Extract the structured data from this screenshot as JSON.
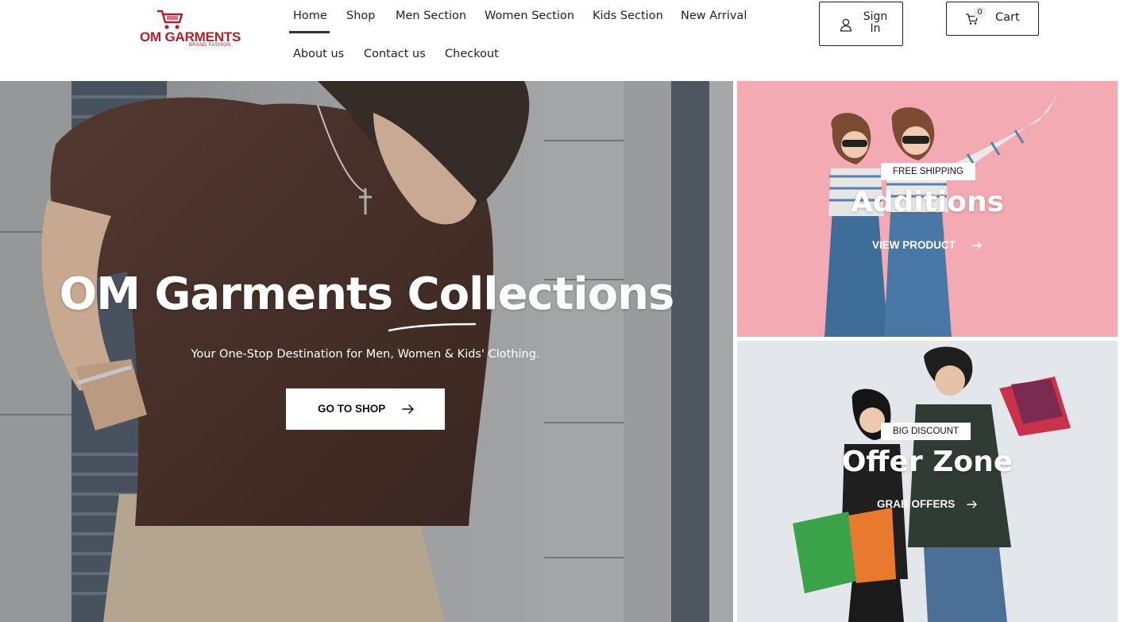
{
  "brand": {
    "name": "OM GARMENTS",
    "tagline": "BRAND FASHION",
    "color": "#b3202a"
  },
  "nav": {
    "items": [
      {
        "label": "Home",
        "active": true
      },
      {
        "label": "Shop"
      },
      {
        "label": "Men Section"
      },
      {
        "label": "Women Section"
      },
      {
        "label": "Kids Section"
      },
      {
        "label": "New Arrival"
      },
      {
        "label": "About us"
      },
      {
        "label": "Contact us"
      },
      {
        "label": "Checkout"
      }
    ]
  },
  "account": {
    "signin_label": "Sign In",
    "signin_icon": "user-icon",
    "cart_label": "Cart",
    "cart_icon": "cart-icon",
    "cart_count": "0"
  },
  "hero": {
    "title": "OM Garments Collections",
    "subtitle": "Your One-Stop Destination for Men, Women & Kids' Clothing.",
    "cta_label": "GO TO SHOP",
    "cta_icon": "arrow-right-icon"
  },
  "banners": [
    {
      "tag": "FREE SHIPPING",
      "title": "Additions",
      "link_label": "VIEW PRODUCT",
      "link_icon": "arrow-right-icon",
      "background": "#f4aab2"
    },
    {
      "tag": "BIG DISCOUNT",
      "title": "Offer Zone",
      "link_label": "GRAB OFFERS",
      "link_icon": "arrow-right-icon",
      "background": "#e3e7ec"
    }
  ]
}
